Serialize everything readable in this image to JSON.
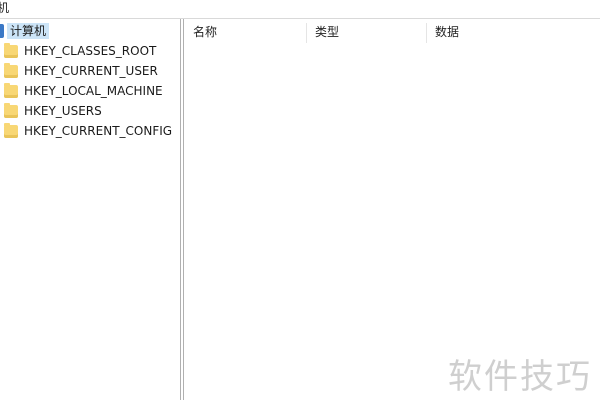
{
  "address": {
    "text": "机"
  },
  "tree": {
    "root_label": "计算机",
    "items": [
      {
        "label": "HKEY_CLASSES_ROOT"
      },
      {
        "label": "HKEY_CURRENT_USER"
      },
      {
        "label": "HKEY_LOCAL_MACHINE"
      },
      {
        "label": "HKEY_USERS"
      },
      {
        "label": "HKEY_CURRENT_CONFIG"
      }
    ]
  },
  "columns": {
    "name": "名称",
    "type": "类型",
    "data": "数据"
  },
  "watermark": {
    "text": "软件技巧"
  },
  "colors": {
    "folder": "#f8d775",
    "selection": "#cce4f7",
    "root_icon": "#3a78c6"
  }
}
